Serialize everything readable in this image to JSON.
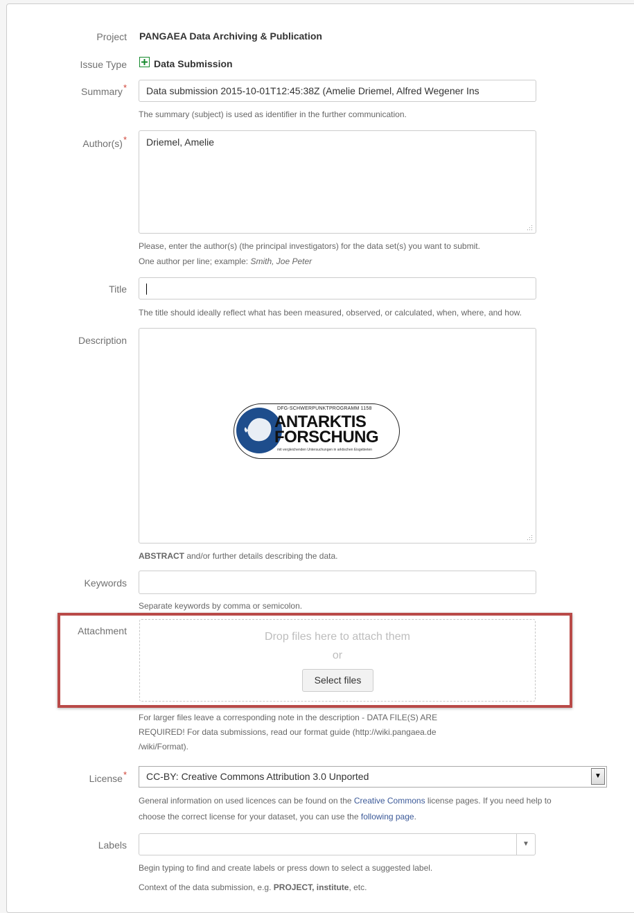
{
  "form": {
    "project": {
      "label": "Project",
      "value": "PANGAEA Data Archiving & Publication"
    },
    "issue_type": {
      "label": "Issue Type",
      "value": "Data Submission",
      "icon": "plus-square-icon"
    },
    "summary": {
      "label": "Summary",
      "required_mark": "*",
      "value": "Data submission 2015-10-01T12:45:38Z (Amelie Driemel, Alfred Wegener Ins",
      "help": "The summary (subject) is used as identifier in the further communication."
    },
    "authors": {
      "label": "Author(s)",
      "required_mark": "*",
      "value": "Driemel, Amelie",
      "help_line1": "Please, enter the author(s) (the principal investigators) for the data set(s) you want to submit.",
      "help_line2_prefix": "One author per line; example: ",
      "help_line2_example": "Smith, Joe Peter"
    },
    "title": {
      "label": "Title",
      "value": "",
      "help": "The title should ideally reflect what has been measured, observed, or calculated, when, where, and how."
    },
    "description": {
      "label": "Description",
      "help_bold": "ABSTRACT",
      "help_rest": " and/or further details describing the data.",
      "logo": {
        "top_text": "DFG-SCHWERPUNKTPROGRAMM 1158",
        "line1": "ANTARKTIS",
        "line2": "FORSCHUNG",
        "bottom_text": "mit vergleichenden Untersuchungen in arktischen Eisgebieten"
      }
    },
    "keywords": {
      "label": "Keywords",
      "value": "",
      "help": "Separate keywords by comma or semicolon."
    },
    "attachment": {
      "label": "Attachment",
      "drop_text": "Drop files here to attach them",
      "or_text": "or",
      "button": "Select files",
      "help_line1": "For larger files leave a corresponding note in the description - DATA FILE(S) ARE",
      "help_line2": "REQUIRED! For data submissions, read our format guide (http://wiki.pangaea.de",
      "help_line3": "/wiki/Format)."
    },
    "license": {
      "label": "License",
      "required_mark": "*",
      "value": "CC-BY: Creative Commons Attribution 3.0 Unported",
      "help_part1": "General information on used licences can be found on the ",
      "help_link1": "Creative Commons",
      "help_part2": " license pages. If you need help to",
      "help_part3": "choose the correct license for your dataset, you can use the ",
      "help_link2": "following page",
      "help_part4": "."
    },
    "labels": {
      "label": "Labels",
      "value": "",
      "help1": "Begin typing to find and create labels or press down to select a suggested label.",
      "help2_prefix": "Context of the data submission, e.g. ",
      "help2_bold": "PROJECT, institute",
      "help2_suffix": ", etc."
    }
  },
  "colors": {
    "required": "#d04437",
    "link": "#3b5998",
    "highlight_border": "#b94a48",
    "icon_green": "#14892c"
  }
}
